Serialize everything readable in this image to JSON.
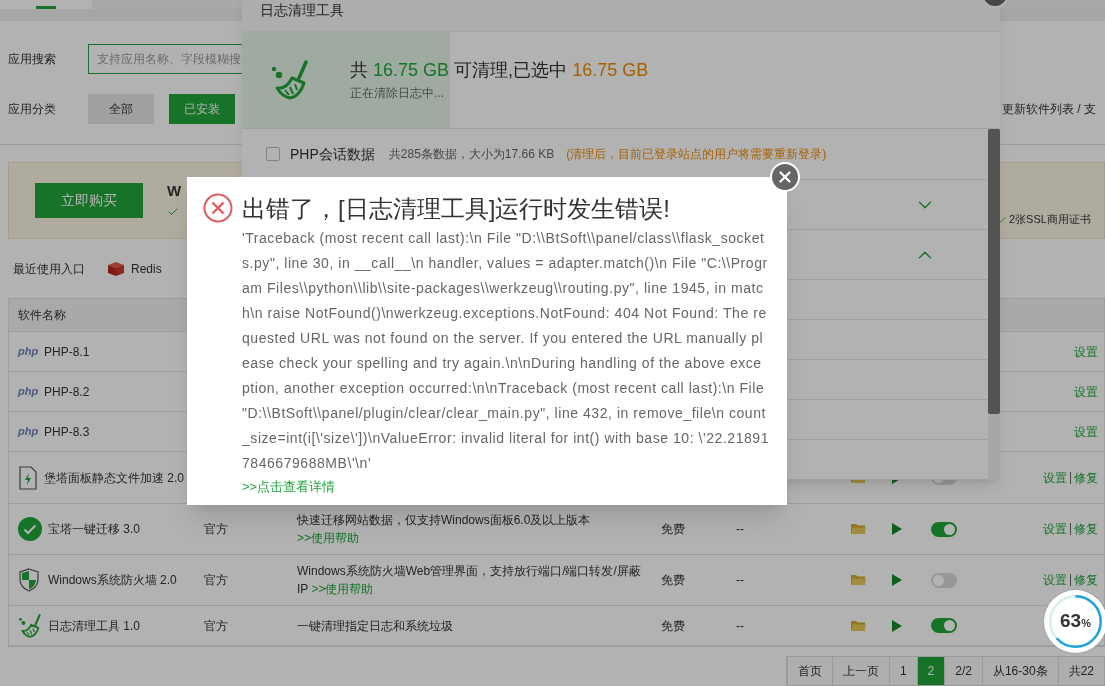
{
  "search": {
    "label": "应用搜索",
    "placeholder": "支持应用名称、字段模糊搜"
  },
  "category": {
    "label": "应用分类",
    "options": [
      {
        "label": "全部",
        "selected": false
      },
      {
        "label": "已安装",
        "selected": true
      }
    ]
  },
  "update_link": "更新软件列表 / 支",
  "banner": {
    "button": "立即购买",
    "title_fragment": "W",
    "feature": "2张SSL商用证书"
  },
  "recent": {
    "label": "最近使用入口",
    "items": [
      "Redis"
    ]
  },
  "table": {
    "columns": [
      "软件名称"
    ],
    "rows": [
      {
        "kind": "php",
        "logo": "php",
        "name": "PHP-8.1",
        "actions": [
          "设置"
        ]
      },
      {
        "kind": "php",
        "logo": "php",
        "name": "PHP-8.2",
        "actions": [
          "设置"
        ]
      },
      {
        "kind": "php",
        "logo": "php",
        "name": "PHP-8.3",
        "actions": [
          "设置"
        ]
      },
      {
        "kind": "file",
        "name": "堡塔面板静态文件加速 2.0",
        "on": false,
        "actions": [
          "设置",
          "修复"
        ]
      },
      {
        "kind": "migration",
        "name": "宝塔一键迁移 3.0",
        "developer": "官方",
        "description": "快速迁移网站数据，仅支持Windows面板6.0及以上版本",
        "help": ">>使用帮助",
        "price": "免费",
        "expiry": "--",
        "on": true,
        "actions": [
          "设置",
          "修复"
        ]
      },
      {
        "kind": "firewall",
        "name": "Windows系统防火墙 2.0",
        "developer": "官方",
        "description": "Windows系统防火墙Web管理界面，支持放行端口/端口转发/屏蔽IP",
        "help": ">>使用帮助",
        "price": "免费",
        "expiry": "--",
        "on": false,
        "actions": [
          "设置",
          "修复"
        ]
      },
      {
        "kind": "cleaner",
        "name": "日志清理工具 1.0",
        "developer": "官方",
        "description": "一键清理指定日志和系统垃圾",
        "price": "免费",
        "expiry": "--",
        "on": true
      }
    ]
  },
  "pagination": [
    {
      "label": "首页",
      "selected": false
    },
    {
      "label": "上一页",
      "selected": false
    },
    {
      "label": "1",
      "selected": false
    },
    {
      "label": "2",
      "selected": true
    },
    {
      "label": "2/2",
      "selected": false
    },
    {
      "label": "从16-30条",
      "selected": false
    },
    {
      "label": "共22",
      "selected": false
    }
  ],
  "clean_tool": {
    "title": "日志清理工具",
    "summary": {
      "prefix": "共",
      "total": "16.75 GB",
      "middle": "可清理,已选中",
      "selected": "16.75 GB"
    },
    "status": "正在清除日志中...",
    "items": [
      {
        "kind": "checkbox",
        "checked": false,
        "name": "PHP会话数据",
        "detail": "共285条数据，大小为17.66 KB",
        "warning": "(清理后，目前已登录站点的用户将需要重新登录)"
      },
      {
        "kind": "group",
        "expanded": false
      },
      {
        "kind": "group",
        "expanded": true
      }
    ]
  },
  "error": {
    "title": "出错了，[日志清理工具]运行时发生错误!",
    "message": "'Traceback (most recent call last):\\n File \"D:\\\\BtSoft\\\\panel/class\\\\flask_sockets.py\", line 30, in __call__\\n handler, values = adapter.match()\\n File \"C:\\\\Program Files\\\\python\\\\lib\\\\site-packages\\\\werkzeug\\\\routing.py\", line 1945, in match\\n raise NotFound()\\nwerkzeug.exceptions.NotFound: 404 Not Found: The requested URL was not found on the server. If you entered the URL manually please check your spelling and try again.\\n\\nDuring handling of the above exception, another exception occurred:\\n\\nTraceback (most recent call last):\\n File \"D:\\\\BtSoft\\\\panel/plugin/clear/clear_main.py\", line 432, in remove_file\\n count_size=int(i[\\'size\\'])\\nValueError: invalid literal for int() with base 10: \\'22.218917846679688MB\\'\\n'",
    "details_link": ">>点击查看详情"
  },
  "progress": {
    "value": "63",
    "unit": "%"
  }
}
